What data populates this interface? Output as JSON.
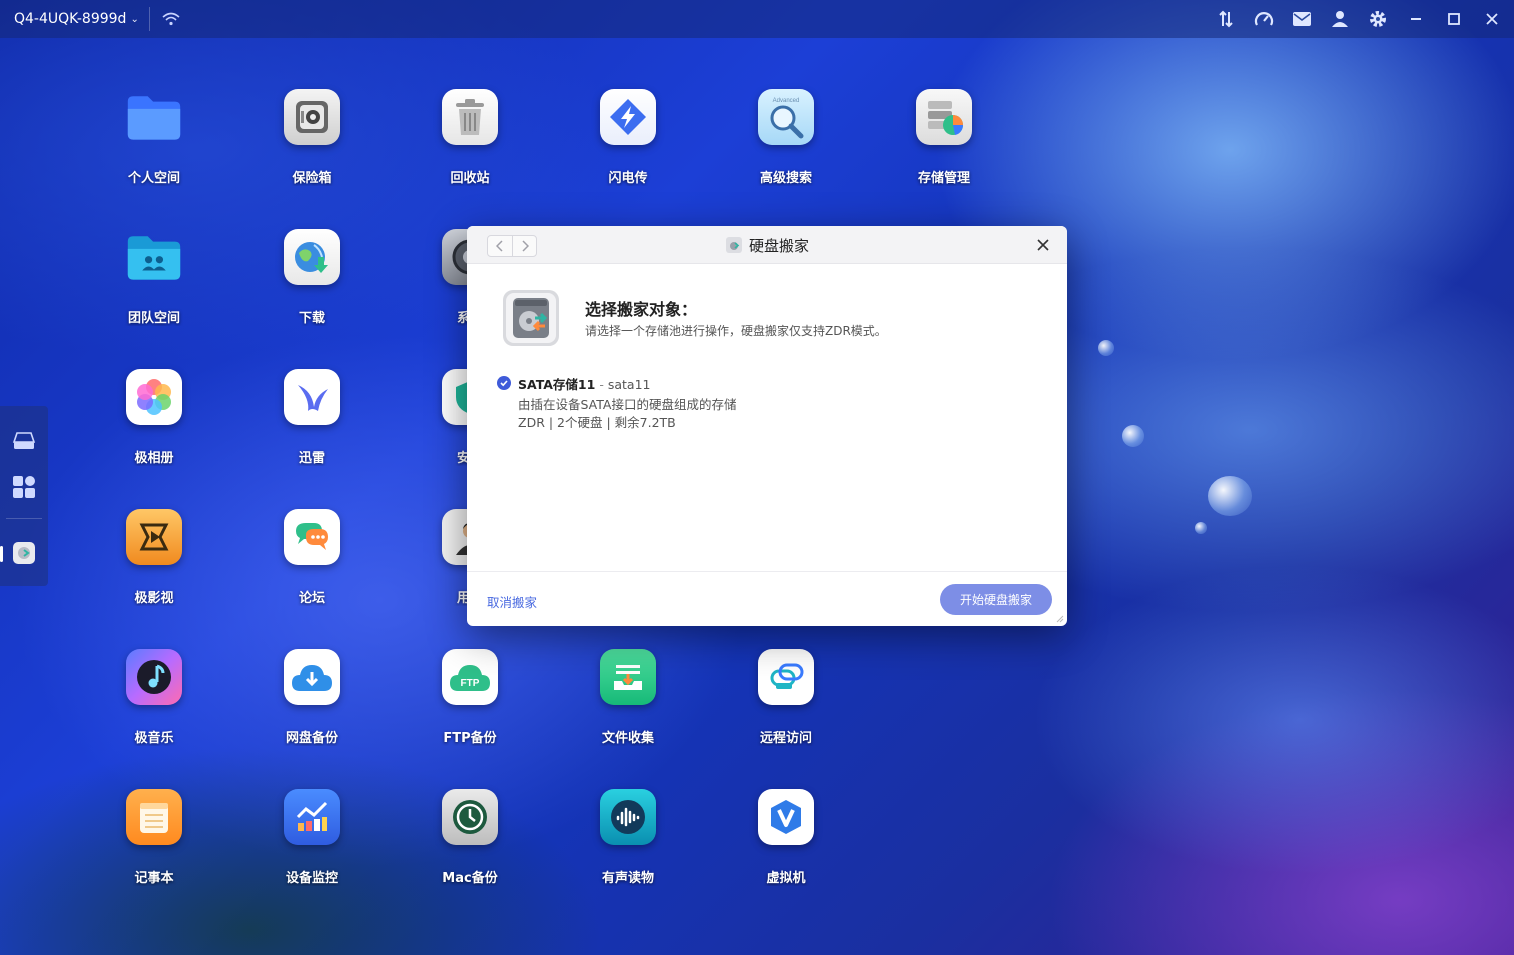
{
  "topbar": {
    "device_name": "Q4-4UQK-8999d",
    "icons": [
      "transfer-icon",
      "speed-icon",
      "mail-icon",
      "user-icon",
      "settings-icon",
      "minimize-icon",
      "maximize-icon",
      "close-icon"
    ]
  },
  "desktop": {
    "apps": [
      {
        "label": "个人空间",
        "icon": "folder-icon"
      },
      {
        "label": "保险箱",
        "icon": "safe-icon"
      },
      {
        "label": "回收站",
        "icon": "trash-icon"
      },
      {
        "label": "闪电传",
        "icon": "lightning-icon"
      },
      {
        "label": "高级搜索",
        "icon": "search-icon"
      },
      {
        "label": "存储管理",
        "icon": "storage-icon"
      },
      {
        "label": "团队空间",
        "icon": "team-folder-icon"
      },
      {
        "label": "下载",
        "icon": "download-globe-icon"
      },
      {
        "label": "系统",
        "icon": "system-icon"
      },
      {
        "label": "极相册",
        "icon": "photos-icon"
      },
      {
        "label": "迅雷",
        "icon": "xunlei-icon"
      },
      {
        "label": "安全",
        "icon": "shield-icon"
      },
      {
        "label": "极影视",
        "icon": "video-icon"
      },
      {
        "label": "论坛",
        "icon": "forum-icon"
      },
      {
        "label": "用户",
        "icon": "user-app-icon"
      },
      {
        "label": "极音乐",
        "icon": "music-icon"
      },
      {
        "label": "网盘备份",
        "icon": "cloud-backup-icon"
      },
      {
        "label": "FTP备份",
        "icon": "ftp-icon"
      },
      {
        "label": "文件收集",
        "icon": "file-collect-icon"
      },
      {
        "label": "远程访问",
        "icon": "remote-access-icon"
      },
      {
        "label": "记事本",
        "icon": "notepad-icon"
      },
      {
        "label": "设备监控",
        "icon": "monitor-icon"
      },
      {
        "label": "Mac备份",
        "icon": "mac-backup-icon"
      },
      {
        "label": "有声读物",
        "icon": "audiobook-icon"
      },
      {
        "label": "虚拟机",
        "icon": "vm-icon"
      }
    ],
    "ftp_text": "FTP",
    "search_badge": "Advanced"
  },
  "dialog": {
    "title": "硬盘搬家",
    "heading": "选择搬家对象：",
    "subtitle": "请选择一个存储池进行操作，硬盘搬家仅支持ZDR模式。",
    "pool": {
      "name": "SATA存储11",
      "separator": "-",
      "id": "sata11",
      "description": "由插在设备SATA接口的硬盘组成的存储",
      "details": "ZDR | 2个硬盘 | 剩余7.2TB",
      "selected": true
    },
    "cancel_label": "取消搬家",
    "start_label": "开始硬盘搬家"
  },
  "colors": {
    "accent": "#3f5bd9",
    "button": "#7d8ee6",
    "link": "#4a6ae0"
  }
}
